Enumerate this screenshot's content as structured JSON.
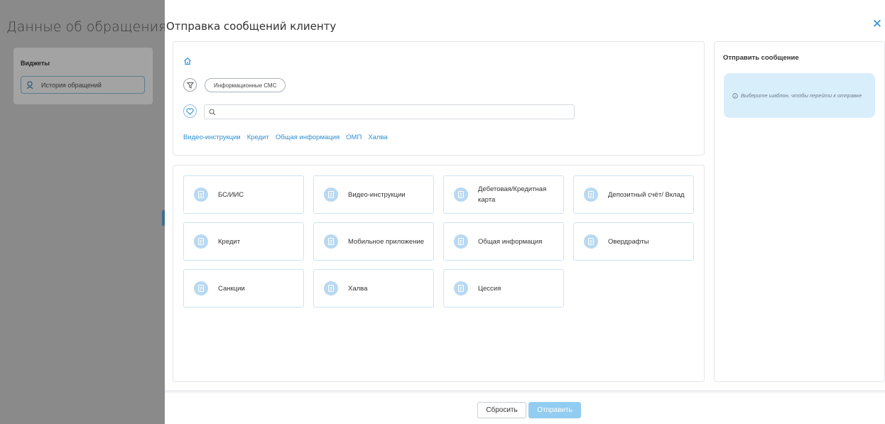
{
  "background": {
    "title": "Данные об обращениях",
    "widgets_label": "Виджеты",
    "history_button": "История обращений"
  },
  "modal": {
    "title": "Отправка сообщений клиенту",
    "close_icon": "close-icon"
  },
  "filters": {
    "category_chip": "Информационные СМС",
    "search_placeholder": "",
    "search_value": "",
    "quick_links": [
      "Видео-инструкции",
      "Кредит",
      "Общая информация",
      "ОМП",
      "Халва"
    ]
  },
  "templates": [
    {
      "label": "БС/ИИС",
      "icon": "document-icon"
    },
    {
      "label": "Видео-инструкции",
      "icon": "document-icon"
    },
    {
      "label": "Дебетовая/Кредитная карта",
      "icon": "document-icon"
    },
    {
      "label": "Депозитный счёт/ Вклад",
      "icon": "document-icon"
    },
    {
      "label": "Кредит",
      "icon": "document-icon"
    },
    {
      "label": "Мобильное приложение",
      "icon": "document-icon"
    },
    {
      "label": "Общая информация",
      "icon": "document-icon"
    },
    {
      "label": "Овердрафты",
      "icon": "document-icon"
    },
    {
      "label": "Санкции",
      "icon": "document-icon"
    },
    {
      "label": "Халва",
      "icon": "document-icon"
    },
    {
      "label": "Цессия",
      "icon": "document-icon"
    }
  ],
  "send_panel": {
    "title": "Отправить сообщение",
    "hint": "Выберите шаблон, чтобы перейти к отправке"
  },
  "footer": {
    "reset_label": "Сбросить",
    "send_label": "Отправить"
  },
  "colors": {
    "accent": "#2d8fd5",
    "send_button": "#92cdf1",
    "hint_background": "#d9eefb",
    "overlay": "#8a8a8a"
  }
}
